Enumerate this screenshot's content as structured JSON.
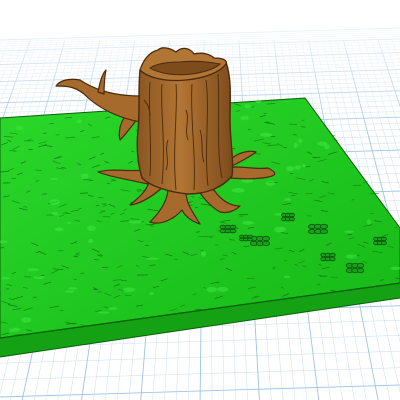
{
  "viewport": {
    "background_color": "#ffffff",
    "grid_color": "#9ec3e6",
    "grid_minor_color": "#c9ddf1"
  },
  "model": {
    "icon": "tree-stump-icon",
    "base_color": "#1ec51e",
    "base_highlight_color": "#39e239",
    "base_edge_color": "#128a12",
    "base_outline_color": "#0a5f0a",
    "stump_color": "#a66a2c",
    "stump_shadow_color": "#7d4b1c",
    "stump_line_color": "#4a2a0c"
  }
}
